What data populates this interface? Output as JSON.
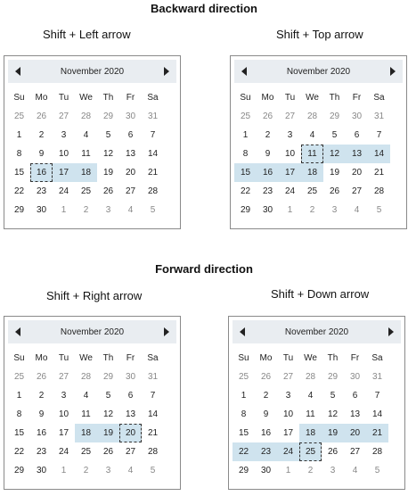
{
  "sections": {
    "backward": "Backward direction",
    "forward": "Forward direction"
  },
  "dow": [
    "Su",
    "Mo",
    "Tu",
    "We",
    "Th",
    "Fr",
    "Sa"
  ],
  "weeks": [
    [
      "25",
      "26",
      "27",
      "28",
      "29",
      "30",
      "31"
    ],
    [
      "1",
      "2",
      "3",
      "4",
      "5",
      "6",
      "7"
    ],
    [
      "8",
      "9",
      "10",
      "11",
      "12",
      "13",
      "14"
    ],
    [
      "15",
      "16",
      "17",
      "18",
      "19",
      "20",
      "21"
    ],
    [
      "22",
      "23",
      "24",
      "25",
      "26",
      "27",
      "28"
    ],
    [
      "29",
      "30",
      "1",
      "2",
      "3",
      "4",
      "5"
    ]
  ],
  "calendars": [
    {
      "caption": "Shift + Left arrow",
      "month": "November 2020",
      "selected": [
        "3-1",
        "3-2",
        "3-3"
      ],
      "focused": "3-1"
    },
    {
      "caption": "Shift + Top arrow",
      "month": "November 2020",
      "selected": [
        "2-3",
        "2-4",
        "2-5",
        "2-6",
        "3-0",
        "3-1",
        "3-2",
        "3-3"
      ],
      "focused": "2-3"
    },
    {
      "caption": "Shift + Right arrow",
      "month": "November 2020",
      "selected": [
        "3-3",
        "3-4",
        "3-5"
      ],
      "focused": "3-5"
    },
    {
      "caption": "Shift + Down arrow",
      "month": "November 2020",
      "selected": [
        "3-3",
        "3-4",
        "3-5",
        "3-6",
        "4-0",
        "4-1",
        "4-2",
        "4-3"
      ],
      "focused": "4-3"
    }
  ]
}
